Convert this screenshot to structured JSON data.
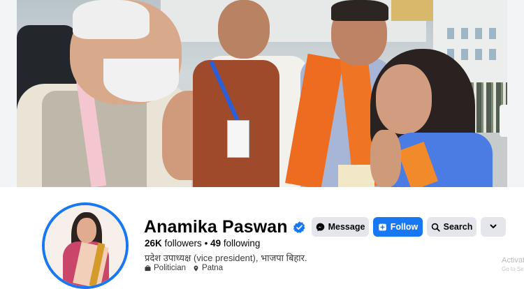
{
  "profile": {
    "name": "Anamika Paswan",
    "followers": "26K",
    "followers_label": "followers",
    "separator": "•",
    "following": "49",
    "following_label": "following",
    "bio": "प्रदेश उपाध्यक्ष (vice president), भाजपा बिहार.",
    "category": "Politician",
    "location": "Patna",
    "verified": true
  },
  "actions": {
    "message_label": "Message",
    "follow_label": "Follow",
    "search_label": "Search",
    "more_icon": "chevron-down-icon"
  },
  "watermark": {
    "line1": "Activate",
    "line2": "Go to Set"
  },
  "colors": {
    "accent": "#1877f2",
    "button_secondary": "#e4e6eb",
    "text_primary": "#050505",
    "text_secondary": "#3a3b3c"
  }
}
